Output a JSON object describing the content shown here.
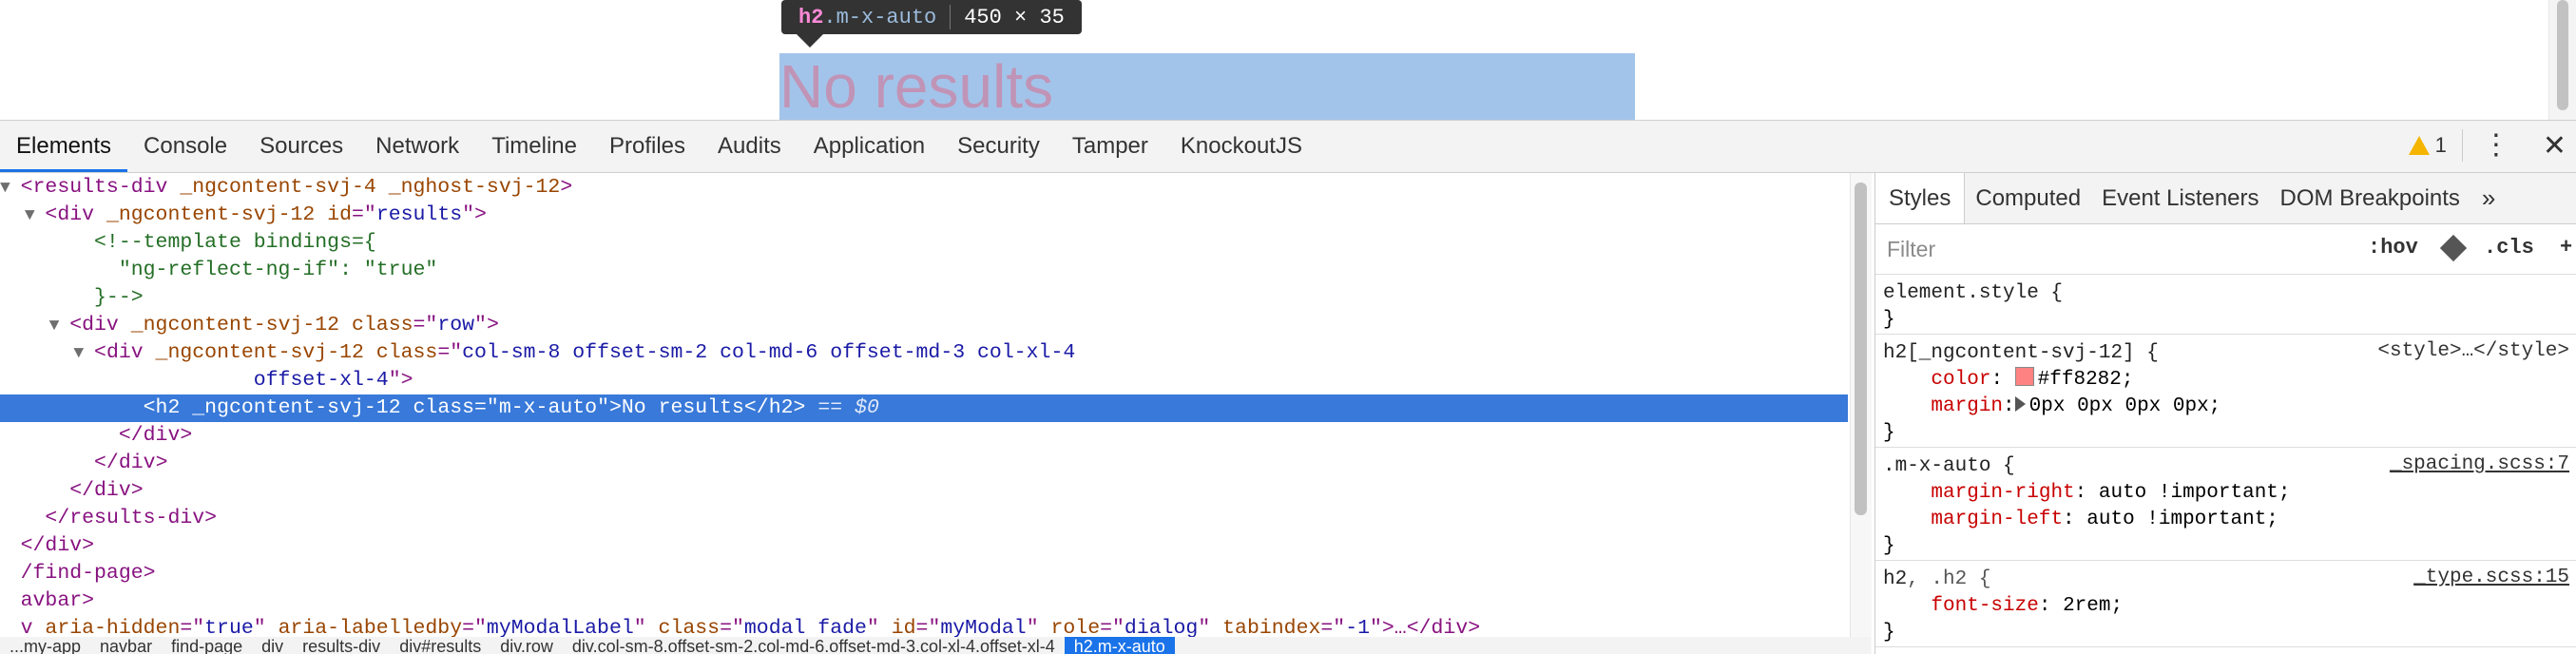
{
  "preview": {
    "tooltip_tag": "h2",
    "tooltip_class": ".m-x-auto",
    "tooltip_size": "450 × 35",
    "heading_text": "No results"
  },
  "toolbar": {
    "tabs": [
      "Elements",
      "Console",
      "Sources",
      "Network",
      "Timeline",
      "Profiles",
      "Audits",
      "Application",
      "Security",
      "Tamper",
      "KnockoutJS"
    ],
    "warning_count": "1",
    "more_icon": "⋮",
    "close_icon": "✕"
  },
  "dom": {
    "lines": [
      {
        "indent": "",
        "arrow": "▼",
        "parts": [
          [
            "p",
            "<"
          ],
          [
            "t",
            "results-div"
          ],
          [
            "an",
            " _ngcontent-svj-4"
          ],
          [
            "an",
            " _nghost-svj-12"
          ],
          [
            "p",
            ">"
          ]
        ]
      },
      {
        "indent": "  ",
        "arrow": "▼",
        "parts": [
          [
            "p",
            "<"
          ],
          [
            "t",
            "div"
          ],
          [
            "an",
            " _ngcontent-svj-12"
          ],
          [
            "an",
            " id"
          ],
          [
            "p",
            "=\""
          ],
          [
            "av",
            "results"
          ],
          [
            "p",
            "\">"
          ]
        ]
      },
      {
        "indent": "      ",
        "arrow": "",
        "parts": [
          [
            "cm",
            "<!--template bindings={"
          ]
        ]
      },
      {
        "indent": "        ",
        "arrow": "",
        "parts": [
          [
            "cm",
            "\"ng-reflect-ng-if\": \"true\""
          ]
        ]
      },
      {
        "indent": "      ",
        "arrow": "",
        "parts": [
          [
            "cm",
            "}-->"
          ]
        ]
      },
      {
        "indent": "    ",
        "arrow": "▼",
        "parts": [
          [
            "p",
            "<"
          ],
          [
            "t",
            "div"
          ],
          [
            "an",
            " _ngcontent-svj-12"
          ],
          [
            "an",
            " class"
          ],
          [
            "p",
            "=\""
          ],
          [
            "av",
            "row"
          ],
          [
            "p",
            "\">"
          ]
        ]
      },
      {
        "indent": "      ",
        "arrow": "▼",
        "parts": [
          [
            "p",
            "<"
          ],
          [
            "t",
            "div"
          ],
          [
            "an",
            " _ngcontent-svj-12"
          ],
          [
            "an",
            " class"
          ],
          [
            "p",
            "=\""
          ],
          [
            "av",
            "col-sm-8 offset-sm-2 col-md-6 offset-md-3 col-xl-4"
          ]
        ]
      },
      {
        "indent": "                   ",
        "arrow": "",
        "parts": [
          [
            "av",
            "offset-xl-4"
          ],
          [
            "p",
            "\">"
          ]
        ]
      },
      {
        "indent": "          ",
        "arrow": "",
        "selected": true,
        "parts": [
          [
            "p",
            "<"
          ],
          [
            "t",
            "h2"
          ],
          [
            "an",
            " _ngcontent-svj-12"
          ],
          [
            "an",
            " class"
          ],
          [
            "p",
            "=\""
          ],
          [
            "av",
            "m-x-auto"
          ],
          [
            "p",
            "\">"
          ],
          [
            "txt",
            "No results"
          ],
          [
            "p",
            "</"
          ],
          [
            "t",
            "h2"
          ],
          [
            "p",
            ">"
          ],
          [
            "eq",
            " == $0"
          ]
        ]
      },
      {
        "indent": "        ",
        "arrow": "",
        "parts": [
          [
            "p",
            "</"
          ],
          [
            "t",
            "div"
          ],
          [
            "p",
            ">"
          ]
        ]
      },
      {
        "indent": "      ",
        "arrow": "",
        "parts": [
          [
            "p",
            "</"
          ],
          [
            "t",
            "div"
          ],
          [
            "p",
            ">"
          ]
        ]
      },
      {
        "indent": "    ",
        "arrow": "",
        "parts": [
          [
            "p",
            "</"
          ],
          [
            "t",
            "div"
          ],
          [
            "p",
            ">"
          ]
        ]
      },
      {
        "indent": "  ",
        "arrow": "",
        "parts": [
          [
            "p",
            "</"
          ],
          [
            "t",
            "results-div"
          ],
          [
            "p",
            ">"
          ]
        ]
      },
      {
        "indent": "",
        "arrow": "",
        "parts": [
          [
            "p",
            "</"
          ],
          [
            "t",
            "div"
          ],
          [
            "p",
            ">"
          ]
        ]
      },
      {
        "indent": "",
        "arrow": "",
        "parts": [
          [
            "p",
            "/"
          ],
          [
            "t",
            "find-page"
          ],
          [
            "p",
            ">"
          ]
        ]
      },
      {
        "indent": "",
        "arrow": "",
        "parts": [
          [
            "t",
            "avbar"
          ],
          [
            "p",
            ">"
          ]
        ]
      },
      {
        "indent": "",
        "arrow": "",
        "parts": [
          [
            "t",
            "v"
          ],
          [
            "an",
            " aria-hidden"
          ],
          [
            "p",
            "=\""
          ],
          [
            "av",
            "true"
          ],
          [
            "p",
            "\""
          ],
          [
            "an",
            " aria-labelledby"
          ],
          [
            "p",
            "=\""
          ],
          [
            "av",
            "myModalLabel"
          ],
          [
            "p",
            "\""
          ],
          [
            "an",
            " class"
          ],
          [
            "p",
            "=\""
          ],
          [
            "av",
            "modal fade"
          ],
          [
            "p",
            "\""
          ],
          [
            "an",
            " id"
          ],
          [
            "p",
            "=\""
          ],
          [
            "av",
            "myModal"
          ],
          [
            "p",
            "\""
          ],
          [
            "an",
            " role"
          ],
          [
            "p",
            "=\""
          ],
          [
            "av",
            "dialog"
          ],
          [
            "p",
            "\""
          ],
          [
            "an",
            " tabindex"
          ],
          [
            "p",
            "=\""
          ],
          [
            "av",
            "-1"
          ],
          [
            "p",
            "\">…</"
          ],
          [
            "t",
            "div"
          ],
          [
            "p",
            ">"
          ]
        ]
      }
    ],
    "breadcrumbs": [
      "...my-app",
      "navbar",
      "find-page",
      "div",
      "results-div",
      "div#results",
      "div.row",
      "div.col-sm-8.offset-sm-2.col-md-6.offset-md-3.col-xl-4.offset-xl-4",
      "h2.m-x-auto"
    ]
  },
  "sidebar": {
    "tabs": [
      "Styles",
      "Computed",
      "Event Listeners",
      "DOM Breakpoints"
    ],
    "more": "»",
    "filter_placeholder": "Filter",
    "hov": ":hov",
    "cls": ".cls",
    "plus": "+",
    "rules": {
      "element_style": {
        "selector": "element.style {",
        "close": "}"
      },
      "h2_ng": {
        "selector": "h2[_ngcontent-svj-12] {",
        "source": "<style>…</style>",
        "color_prop": "color",
        "color_val": "#ff8282;",
        "swatch": "#ff8282",
        "margin_prop": "margin",
        "margin_val": "0px 0px 0px 0px;",
        "close": "}"
      },
      "mxauto": {
        "selector": ".m-x-auto {",
        "source": "_spacing.scss:7",
        "p1": "margin-right",
        "v1": "auto !important;",
        "p2": "margin-left",
        "v2": "auto !important;",
        "close": "}"
      },
      "h2": {
        "selector_a": "h2",
        "selector_b": ", .h2 {",
        "source": "_type.scss:15",
        "p1": "font-size",
        "v1": "2rem;",
        "close": "}"
      }
    }
  }
}
